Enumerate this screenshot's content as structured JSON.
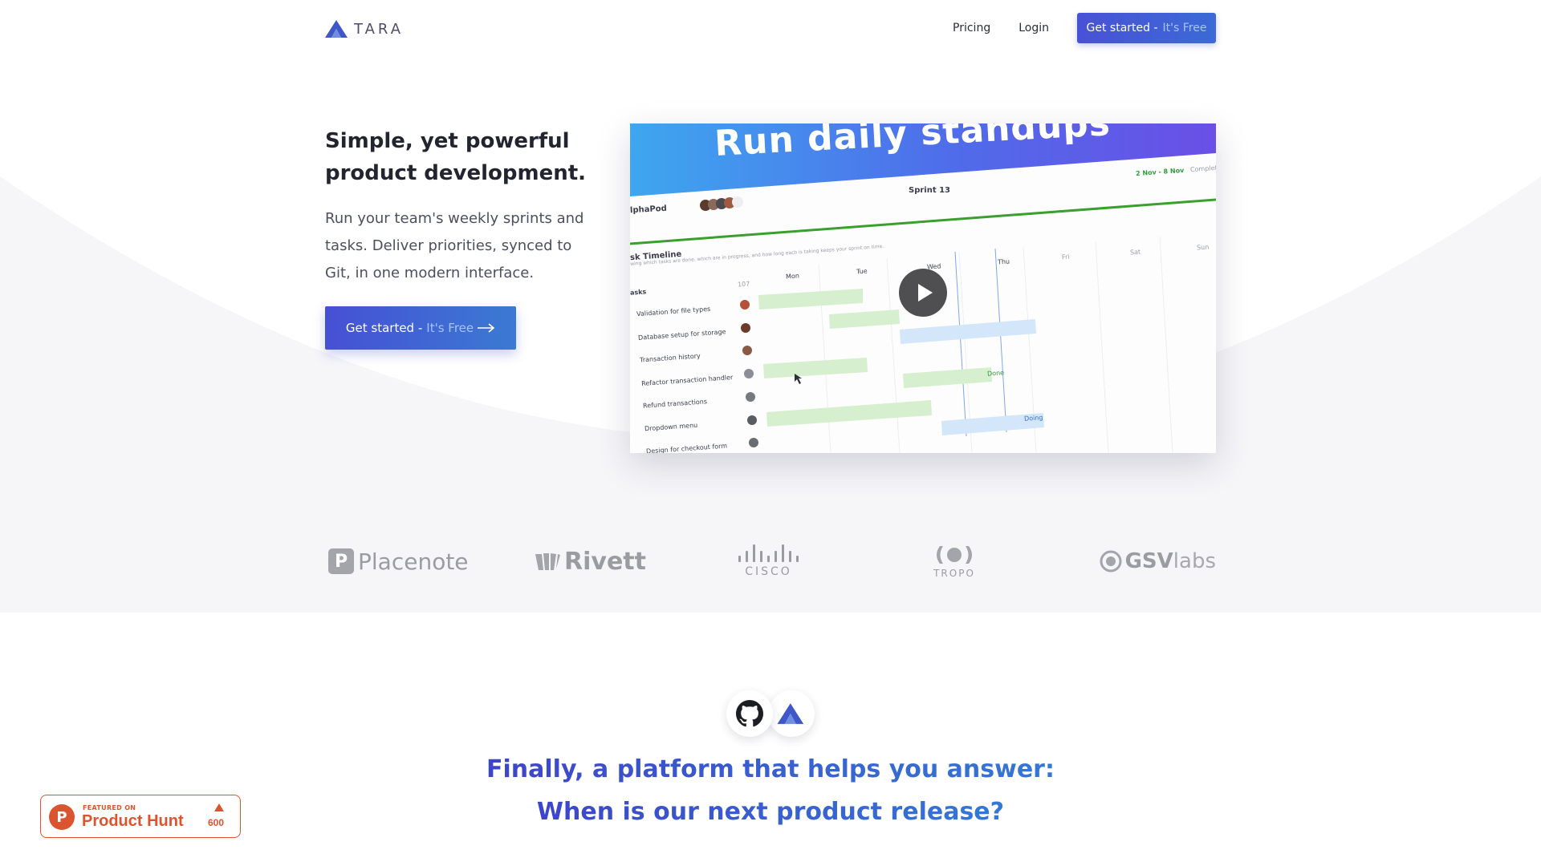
{
  "brand": {
    "name": "TARA",
    "accent": "#4951d6",
    "accent_2": "#3b7ad3"
  },
  "nav": {
    "links": [
      "Pricing",
      "Login"
    ],
    "cta": {
      "label": "Get started - ",
      "highlight": "It's Free"
    }
  },
  "hero": {
    "title": "Simple, yet powerful product development.",
    "subtitle": "Run your team's weekly sprints and tasks. Deliver priorities, synced to Git, in one modern interface.",
    "cta": {
      "label": "Get started - ",
      "highlight": "It's Free",
      "icon": "arrow-right-icon"
    }
  },
  "video": {
    "banner": "Run daily standups",
    "sprint": "Sprint 13",
    "date_range": "2 Nov - 8 Nov",
    "complete_label": "Complet",
    "team": "lphaPod",
    "section_title": "sk Timeline",
    "section_desc": "wing which tasks are done, which are in progress, and how long each is taking keeps your sprint on time.",
    "tasks_header": "asks",
    "count": "107",
    "days": [
      "Mon",
      "Tue",
      "Wed",
      "Thu",
      "Fri",
      "Sat",
      "Sun"
    ],
    "tasks": [
      "Validation for file types",
      "Database setup for storage",
      "Transaction history",
      "Refactor transaction handler",
      "Refund transactions",
      "Dropdown menu",
      "Design for checkout form"
    ],
    "statuses": [
      "Done",
      "Doing"
    ],
    "play_icon": "play-icon"
  },
  "logos": {
    "items": [
      "Placenote",
      "Rivett",
      "CISCO",
      "TROPO",
      "GSVlabs"
    ],
    "gsv_bold": "GSV",
    "gsv_light": "labs"
  },
  "integration": {
    "icons": [
      "github-icon",
      "tara-logo-icon"
    ]
  },
  "answer": {
    "line1": "Finally, a platform that helps you answer:",
    "line2": "When is our next product release?"
  },
  "product_hunt": {
    "featured": "FEATURED ON",
    "name": "Product Hunt",
    "count": "600",
    "color": "#da552f"
  }
}
